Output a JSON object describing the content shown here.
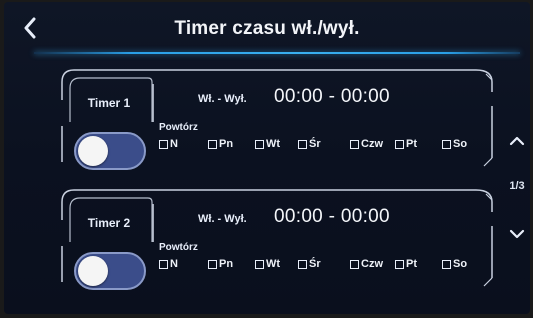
{
  "header": {
    "title": "Timer czasu wł./wył."
  },
  "timers": [
    {
      "label": "Timer 1",
      "schedule_label": "Wł. - Wył.",
      "time_range": "00:00 - 00:00",
      "repeat_label": "Powtórz",
      "enabled": false,
      "days": [
        "N",
        "Pn",
        "Wt",
        "Śr",
        "Czw",
        "Pt",
        "So"
      ]
    },
    {
      "label": "Timer 2",
      "schedule_label": "Wł. - Wył.",
      "time_range": "00:00 - 00:00",
      "repeat_label": "Powtórz",
      "enabled": false,
      "days": [
        "N",
        "Pn",
        "Wt",
        "Śr",
        "Czw",
        "Pt",
        "So"
      ]
    }
  ],
  "pager": {
    "indicator": "1/3"
  },
  "colors": {
    "accent": "#2a9fe6",
    "background": "#0b1120",
    "toggle_track": "#3b4d8a"
  },
  "icons": {
    "back": "chevron-left-icon",
    "page_up": "chevron-up-icon",
    "page_down": "chevron-down-icon"
  }
}
